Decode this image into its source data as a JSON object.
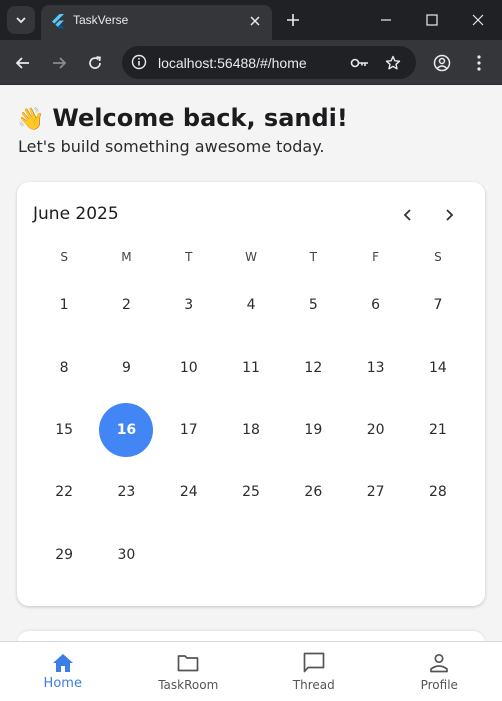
{
  "browser": {
    "tab_title": "TaskVerse",
    "url": "localhost:56488/#/home"
  },
  "header": {
    "greeting": "Welcome back, sandi!",
    "wave_emoji": "👋",
    "subtitle": "Let's build something awesome today."
  },
  "calendar": {
    "month_label": "June 2025",
    "weekdays": [
      "S",
      "M",
      "T",
      "W",
      "T",
      "F",
      "S"
    ],
    "weeks": [
      [
        "1",
        "2",
        "3",
        "4",
        "5",
        "6",
        "7"
      ],
      [
        "8",
        "9",
        "10",
        "11",
        "12",
        "13",
        "14"
      ],
      [
        "15",
        "16",
        "17",
        "18",
        "19",
        "20",
        "21"
      ],
      [
        "22",
        "23",
        "24",
        "25",
        "26",
        "27",
        "28"
      ],
      [
        "29",
        "30",
        "",
        "",
        "",
        "",
        ""
      ]
    ],
    "selected_day": "16",
    "accent_color": "#4285f4"
  },
  "fab": {
    "icon": "plus-icon",
    "color": "#ecdefc"
  },
  "bottom_nav": {
    "items": [
      {
        "label": "Home",
        "icon": "home-icon",
        "active": true
      },
      {
        "label": "TaskRoom",
        "icon": "folder-icon",
        "active": false
      },
      {
        "label": "Thread",
        "icon": "chat-icon",
        "active": false
      },
      {
        "label": "Profile",
        "icon": "person-icon",
        "active": false
      }
    ],
    "active_color": "#3d7de8"
  }
}
